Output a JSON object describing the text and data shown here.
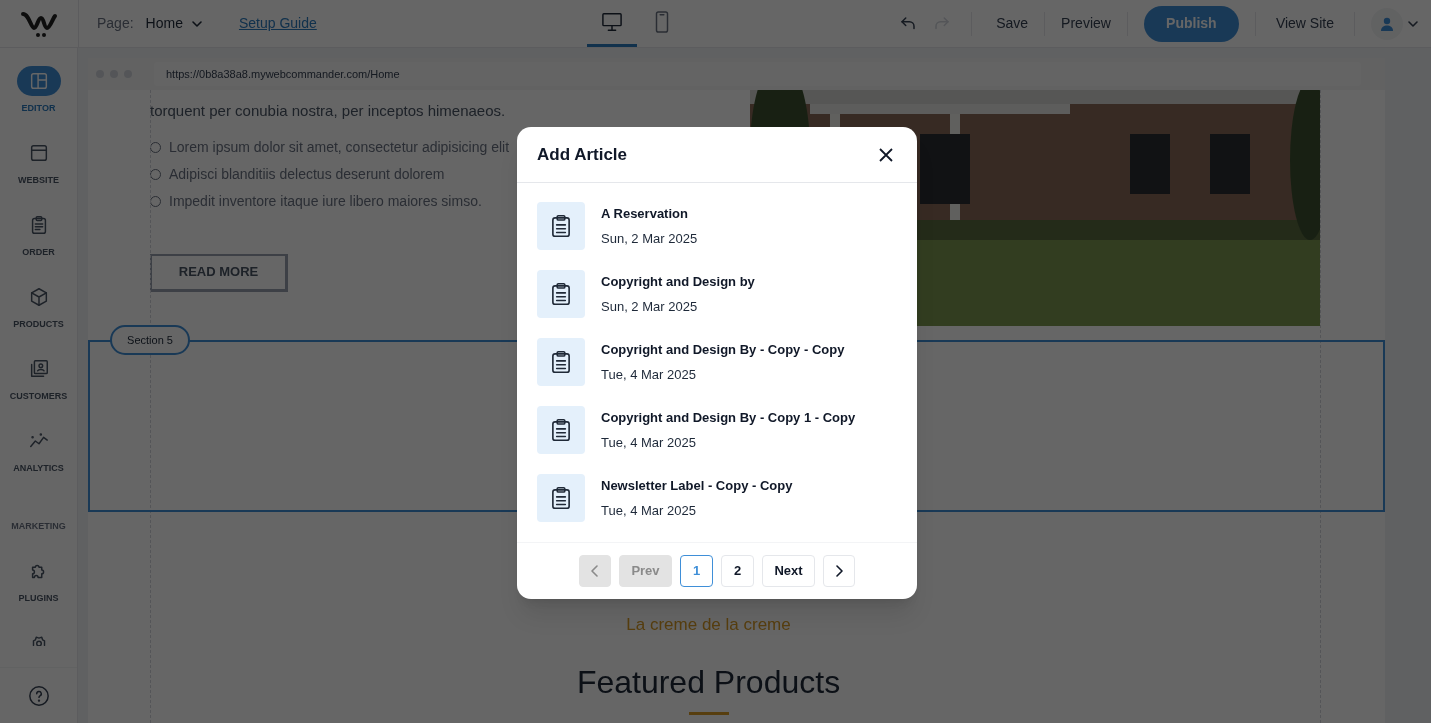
{
  "topbar": {
    "page_label": "Page:",
    "page_name": "Home",
    "setup_link": "Setup Guide",
    "devices": [
      {
        "selected": true
      },
      {
        "selected": false
      }
    ],
    "actions": [
      "Save",
      "Preview"
    ],
    "publish": "Publish",
    "view_site": "View Site"
  },
  "sidebar": {
    "items": [
      {
        "kind": "item",
        "label": "EDITOR",
        "selected": true
      },
      {
        "kind": "item",
        "label": "WEBSITE",
        "selected": false
      },
      {
        "kind": "item",
        "label": "ORDER",
        "selected": false
      },
      {
        "kind": "item",
        "label": "PRODUCTS",
        "selected": false
      },
      {
        "kind": "item",
        "label": "CUSTOMERS",
        "selected": false
      },
      {
        "kind": "item",
        "label": "ANALYTICS",
        "selected": false
      },
      {
        "kind": "heading",
        "label": "MARKETING"
      },
      {
        "kind": "item",
        "label": "PLUGINS",
        "selected": false
      }
    ]
  },
  "browser": {
    "url": "https://0b8a38a8.mywebcommander.com/Home"
  },
  "content": {
    "paragraph": "torquent per conubia nostra, per inceptos himenaeos.",
    "bullets": [
      "Lorem ipsum dolor sit amet, consectetur adipisicing elit",
      "Adipisci blanditiis delectus deserunt dolorem",
      "Impedit inventore itaque iure libero maiores simso."
    ],
    "read_more": "READ MORE",
    "section_label": "Section 5",
    "tagline": "La creme de la creme",
    "heading": "Featured Products"
  },
  "dialog": {
    "title": "Add Article",
    "articles": [
      {
        "title": "A Reservation",
        "date": "Sun, 2 Mar 2025"
      },
      {
        "title": "Copyright and Design by",
        "date": "Sun, 2 Mar 2025"
      },
      {
        "title": "Copyright and Design By - Copy - Copy",
        "date": "Tue, 4 Mar 2025"
      },
      {
        "title": "Copyright and Design By - Copy 1 - Copy",
        "date": "Tue, 4 Mar 2025"
      },
      {
        "title": "Newsletter Label - Copy - Copy",
        "date": "Tue, 4 Mar 2025"
      }
    ],
    "pagination": [
      {
        "kind": "prev-arrow",
        "disabled": true
      },
      {
        "kind": "text",
        "label": "Prev",
        "disabled": true
      },
      {
        "kind": "page",
        "label": "1",
        "selected": true
      },
      {
        "kind": "page",
        "label": "2",
        "selected": false
      },
      {
        "kind": "text",
        "label": "Next",
        "disabled": false
      },
      {
        "kind": "next-arrow",
        "disabled": false
      }
    ]
  }
}
